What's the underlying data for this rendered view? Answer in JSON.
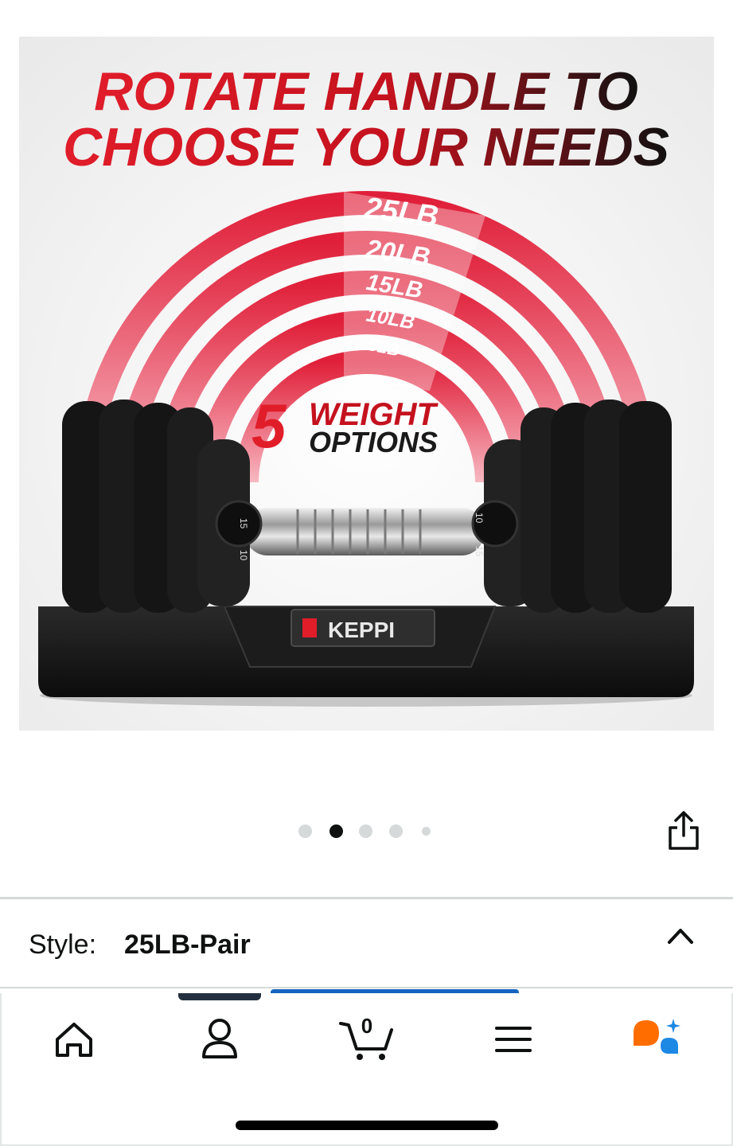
{
  "product_image": {
    "headline_line1": "ROTATE HANDLE TO",
    "headline_line2": "CHOOSE YOUR NEEDS",
    "weight_labels": [
      "25LB",
      "20LB",
      "15LB",
      "10LB",
      "5LB"
    ],
    "options_number": "5",
    "options_text_line1": "WEIGHT",
    "options_text_line2": "OPTIONS",
    "brand": "KEPPI",
    "dial_numbers": [
      "15",
      "10",
      "10",
      "15"
    ],
    "colors": {
      "accent_red": "#e11d2a",
      "dark_red": "#8b0000",
      "plate_black": "#151515"
    }
  },
  "carousel": {
    "dot_count": 5,
    "active_index": 1
  },
  "share": {
    "icon": "share-icon"
  },
  "style_selector": {
    "label": "Style:",
    "value": "25LB-Pair",
    "icon": "chevron-up-icon"
  },
  "bottom_nav": {
    "items": [
      {
        "name": "home",
        "icon": "home-icon"
      },
      {
        "name": "account",
        "icon": "person-icon"
      },
      {
        "name": "cart",
        "icon": "cart-icon",
        "count": "0"
      },
      {
        "name": "menu",
        "icon": "hamburger-menu-icon"
      },
      {
        "name": "assistant",
        "icon": "ai-assistant-icon"
      }
    ]
  },
  "colors": {
    "text": "#0f1111",
    "dot_inactive": "#d5d9d9",
    "dot_active": "#0f1111",
    "nav_dark": "#232f3e",
    "link_blue": "#1565c0",
    "assistant_orange": "#ff6d00",
    "assistant_blue": "#1e88e5"
  }
}
